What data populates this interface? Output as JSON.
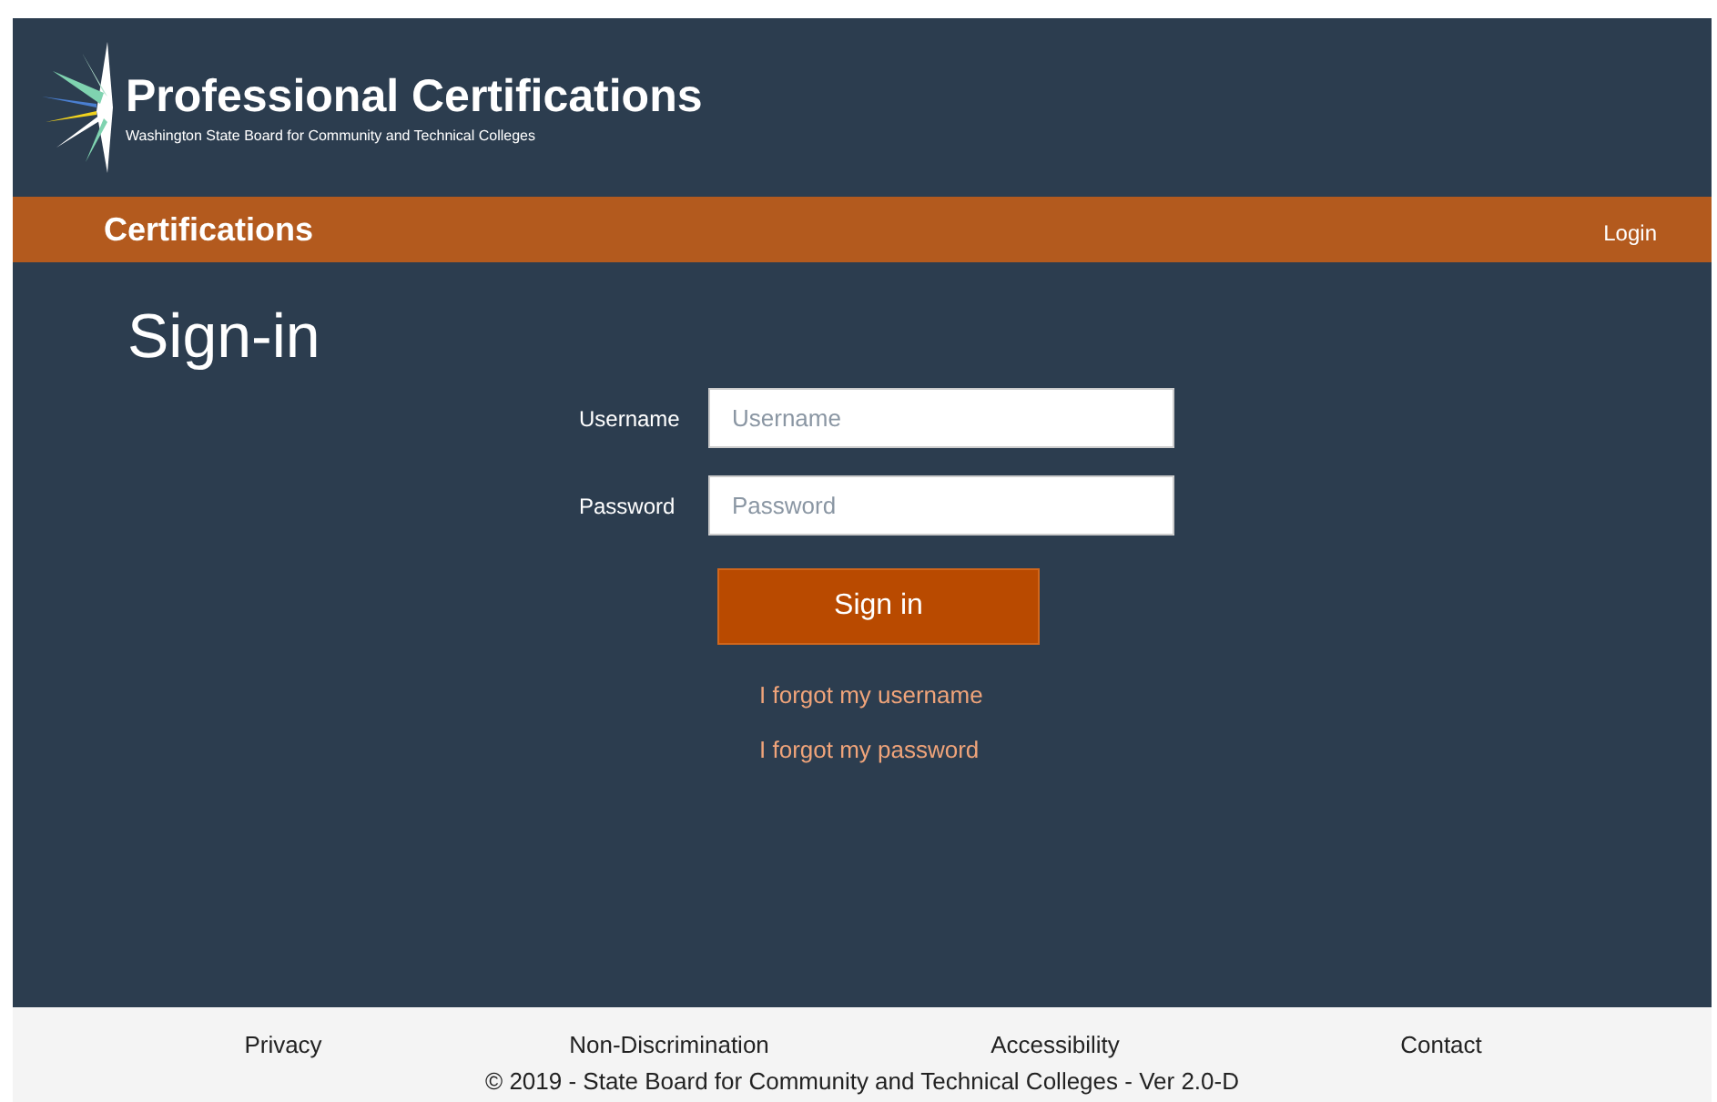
{
  "header": {
    "title": "Professional Certifications",
    "subtitle": "Washington State Board for Community and Technical Colleges"
  },
  "navbar": {
    "brand": "Certifications",
    "links": [
      "Login"
    ]
  },
  "page_title": "Sign-in",
  "form": {
    "fields": [
      {
        "label": "Username",
        "placeholder": "Username"
      },
      {
        "label": "Password",
        "placeholder": "Password"
      }
    ],
    "submit": "Sign in",
    "links": [
      "I forgot my username",
      "I forgot my password"
    ]
  },
  "footer": {
    "links": [
      "Privacy",
      "Non-Discrimination",
      "Accessibility",
      "Contact"
    ],
    "copyright": "© 2019 - State Board for Community and Technical Colleges - Ver 2.0-D"
  }
}
